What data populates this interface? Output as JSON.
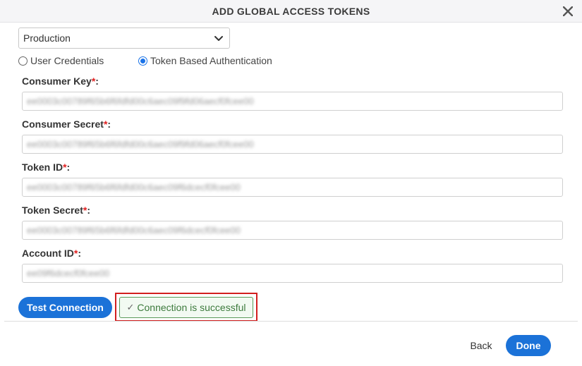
{
  "dialog": {
    "title": "ADD GLOBAL ACCESS TOKENS"
  },
  "environment": {
    "selected": "Production"
  },
  "auth_options": [
    {
      "label": "User Credentials",
      "checked": false
    },
    {
      "label": "Token Based Authentication",
      "checked": true
    }
  ],
  "fields": {
    "consumer_key": {
      "label": "Consumer Key",
      "required_mark": "*",
      "suffix": ":",
      "value": "ee0003c00789f65b6f6fdfd00c6aec09f9fd06aecf0fcee00"
    },
    "consumer_secret": {
      "label": "Consumer Secret",
      "required_mark": "*",
      "suffix": ":",
      "value": "ee0003c00789f65b6f6fdfd00c6aec09f9fd06aecf0fcee00"
    },
    "token_id": {
      "label": "Token ID",
      "required_mark": "*",
      "suffix": ":",
      "value": "ee0003c00789f65b6f6fdfd00c6aec09f6dcecf0fcee00"
    },
    "token_secret": {
      "label": "Token Secret",
      "required_mark": "*",
      "suffix": ":",
      "value": "ee0003c00789f65b6f6fdfd00c6aec09f6dcecf0fcee00"
    },
    "account_id": {
      "label": "Account ID",
      "required_mark": "*",
      "suffix": ":",
      "value": "ee09f6dcecf0fcee00"
    }
  },
  "actions": {
    "test_connection": "Test Connection",
    "success_message": "Connection is successful",
    "back": "Back",
    "done": "Done"
  },
  "icons": {
    "close": "close-icon",
    "dropdown": "chevron-down-icon",
    "check": "check-icon"
  },
  "colors": {
    "primary": "#1b72d8",
    "success_border": "#5a9a5a",
    "success_text": "#3c7a3c",
    "highlight": "#d21f1f",
    "required": "#e02020"
  }
}
